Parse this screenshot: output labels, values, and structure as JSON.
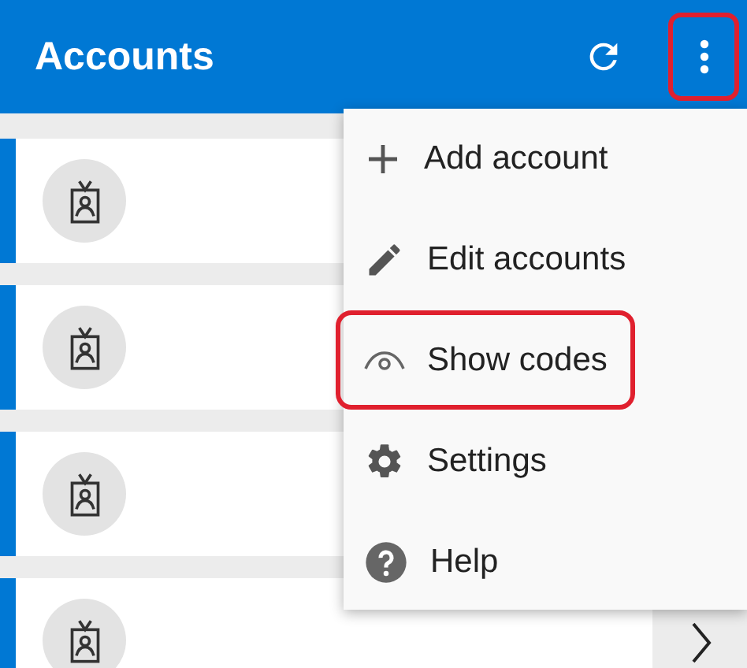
{
  "app_bar": {
    "title": "Accounts",
    "more_highlighted": true
  },
  "accounts": [
    {
      "kind": "account"
    },
    {
      "kind": "account"
    },
    {
      "kind": "account"
    },
    {
      "kind": "account"
    }
  ],
  "next_chevron": true,
  "menu": {
    "items": [
      {
        "kind": "add",
        "label": "Add account",
        "highlighted": false
      },
      {
        "kind": "edit",
        "label": "Edit accounts",
        "highlighted": false
      },
      {
        "kind": "eye",
        "label": "Show codes",
        "highlighted": true
      },
      {
        "kind": "gear",
        "label": "Settings",
        "highlighted": false
      },
      {
        "kind": "help",
        "label": "Help",
        "highlighted": false
      }
    ]
  }
}
